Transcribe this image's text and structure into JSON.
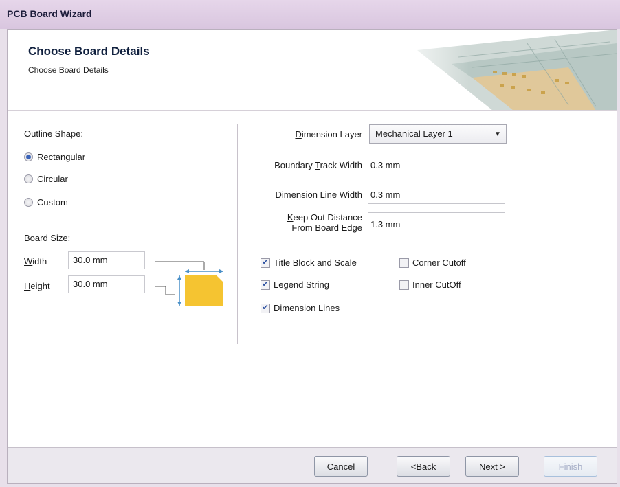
{
  "window": {
    "title": "PCB Board Wizard"
  },
  "header": {
    "title": "Choose Board Details",
    "subtitle": "Choose Board Details"
  },
  "outline": {
    "label": "Outline Shape:",
    "options": [
      {
        "label": "Rectangular",
        "selected": true
      },
      {
        "label": "Circular",
        "selected": false
      },
      {
        "label": "Custom",
        "selected": false
      }
    ]
  },
  "board_size": {
    "label": "Board Size:",
    "width_label": "Width",
    "width_value": "30.0 mm",
    "height_label": "Height",
    "height_value": "30.0 mm"
  },
  "settings": {
    "dimension_layer_label": "Dimension Layer",
    "dimension_layer_value": "Mechanical Layer 1",
    "boundary_track_label": "Boundary Track Width",
    "boundary_track_value": "0.3 mm",
    "dimension_line_label": "Dimension Line Width",
    "dimension_line_value": "0.3 mm",
    "keep_out_label_1": "Keep Out Distance",
    "keep_out_label_2": "From Board Edge",
    "keep_out_value": "1.3 mm"
  },
  "checks": [
    {
      "label": "Title Block and Scale",
      "checked": true
    },
    {
      "label": "Legend String",
      "checked": true
    },
    {
      "label": "Dimension Lines",
      "checked": true
    },
    {
      "label": "Corner Cutoff",
      "checked": false
    },
    {
      "label": "Inner CutOff",
      "checked": false
    }
  ],
  "buttons": {
    "cancel": "Cancel",
    "back": "< Back",
    "next": "Next >",
    "finish": "Finish"
  },
  "colors": {
    "board_fill": "#f5c431",
    "arrow": "#4a90c8",
    "accent_radio": "#3a63b8"
  }
}
